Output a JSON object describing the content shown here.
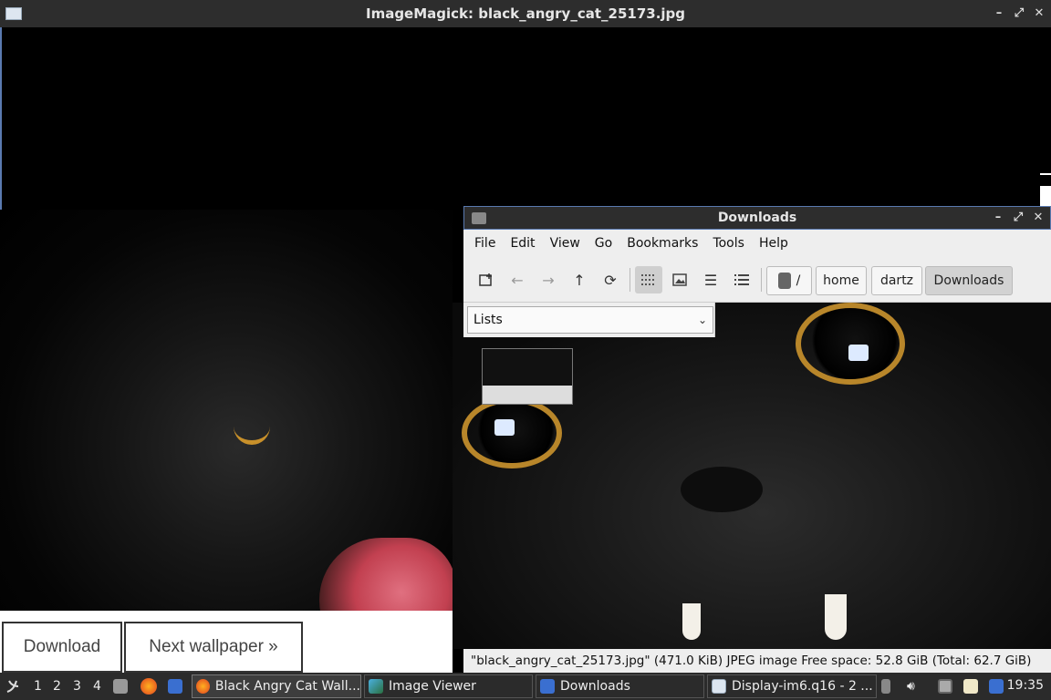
{
  "imagemagick": {
    "title": "ImageMagick: black_angry_cat_25173.jpg",
    "controls": [
      "–",
      "⤢",
      "✕"
    ]
  },
  "webpage": {
    "download_label": "Download",
    "next_label": "Next wallpaper »"
  },
  "filemanager": {
    "title": "Downloads",
    "controls": [
      "–",
      "⤢",
      "✕"
    ],
    "menu": [
      "File",
      "Edit",
      "View",
      "Go",
      "Bookmarks",
      "Tools",
      "Help"
    ],
    "breadcrumb": {
      "root": "/",
      "items": [
        "home",
        "dartz",
        "Downloads"
      ]
    },
    "side_select": "Lists",
    "status": "\"black_angry_cat_25173.jpg\" (471.0 KiB) JPEG image    Free space: 52.8 GiB (Total: 62.7 GiB)"
  },
  "taskbar": {
    "desktops": [
      "1",
      "2",
      "3",
      "4"
    ],
    "tasks": [
      {
        "label": "Black Angry Cat Wall...",
        "icon": "firefox-icon"
      },
      {
        "label": "Image Viewer",
        "icon": "image-viewer-icon"
      },
      {
        "label": "Downloads",
        "icon": "folder-icon"
      },
      {
        "label": "Display-im6.q16 - 2 ...",
        "icon": "window-icon"
      }
    ],
    "clock": "19:35"
  },
  "colors": {
    "titlebar": "#2d2d2d",
    "window_border": "#5a7ab0",
    "panel": "#eeeeee",
    "taskbar": "#2b2b2b",
    "eye_gold": "#b8862a"
  }
}
